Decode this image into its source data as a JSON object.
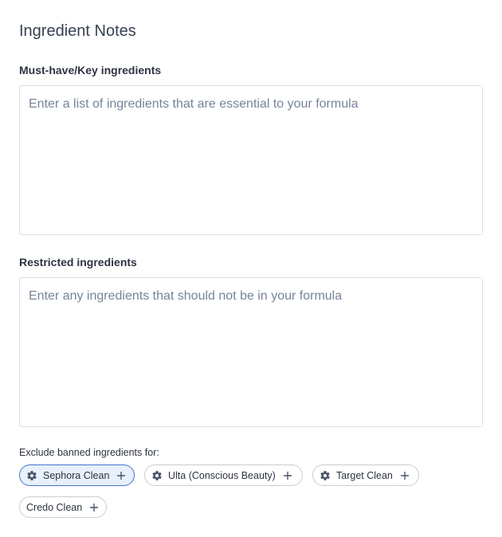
{
  "section": {
    "title": "Ingredient Notes"
  },
  "key_ingredients": {
    "label": "Must-have/Key ingredients",
    "placeholder": "Enter a list of ingredients that are essential to your formula",
    "value": ""
  },
  "restricted_ingredients": {
    "label": "Restricted ingredients",
    "placeholder": "Enter any ingredients that should not be in your formula",
    "value": ""
  },
  "exclude": {
    "label": "Exclude banned ingredients for:",
    "chips": [
      {
        "label": "Sephora Clean",
        "selected": true,
        "icon": "gear-icon",
        "action_icon": "plus-icon"
      },
      {
        "label": "Ulta (Conscious Beauty)",
        "selected": false,
        "icon": "gear-icon",
        "action_icon": "plus-icon"
      },
      {
        "label": "Target Clean",
        "selected": false,
        "icon": "gear-icon",
        "action_icon": "plus-icon"
      },
      {
        "label": "Credo Clean",
        "selected": false,
        "icon": "",
        "action_icon": "plus-icon"
      }
    ]
  },
  "colors": {
    "selected_chip_bg": "#e8f0fb",
    "selected_chip_border": "#3d78c6",
    "chip_border": "#c9cdd4",
    "placeholder": "#77849a",
    "icon": "#4a5568"
  }
}
